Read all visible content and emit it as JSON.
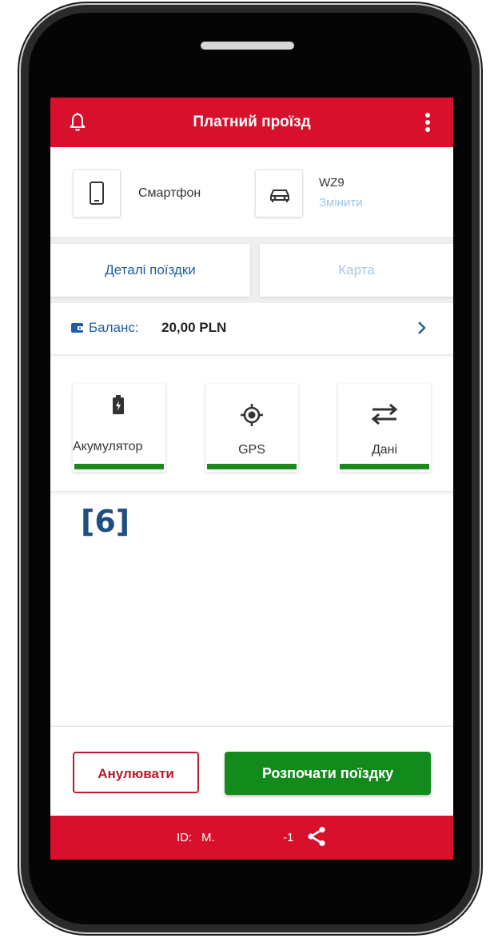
{
  "header": {
    "title": "Платний проїзд",
    "accent_color": "#d8102c",
    "left_icon": "bell-icon",
    "right_icon": "more-vertical-icon"
  },
  "device": {
    "icon": "smartphone-icon",
    "label": "Смартфон"
  },
  "vehicle": {
    "icon": "car-icon",
    "plate": "WZ9",
    "change_label": "Змінити"
  },
  "tabs": [
    {
      "label": "Деталі поїздки",
      "active": true
    },
    {
      "label": "Карта",
      "active": false
    }
  ],
  "balance": {
    "icon": "wallet-icon",
    "label": "Баланс:",
    "value": "20,00 PLN",
    "chevron": "chevron-right-icon"
  },
  "status_cards": [
    {
      "icon": "battery-charging-icon",
      "label": "Акумулятор",
      "status_color": "#1a8a1a"
    },
    {
      "icon": "gps-icon",
      "label": "GPS",
      "status_color": "#1a8a1a"
    },
    {
      "icon": "data-transfer-icon",
      "label": "Дані",
      "status_color": "#1a8a1a"
    }
  ],
  "annotation": "[6]",
  "buttons": {
    "cancel": "Анулювати",
    "start": "Розпочати поїздку",
    "cancel_color": "#b51c2c",
    "start_color": "#138a1c"
  },
  "footer": {
    "id_label": "ID:",
    "id_value": "M.",
    "id_suffix": "-1",
    "share_icon": "share-icon"
  }
}
